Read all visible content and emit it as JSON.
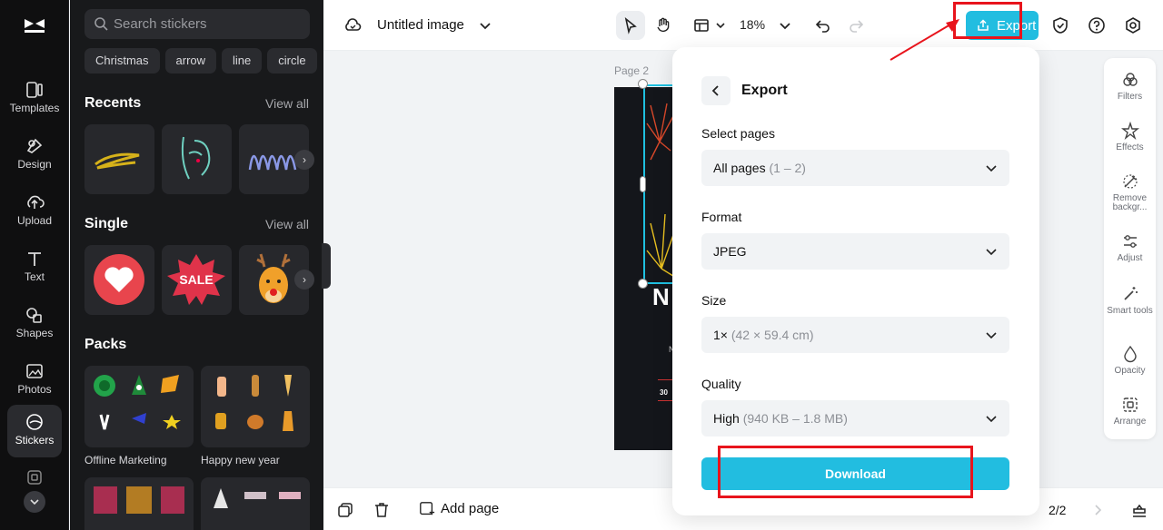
{
  "nav": {
    "items": [
      {
        "label": "Templates",
        "icon": "templates-icon"
      },
      {
        "label": "Design",
        "icon": "design-icon"
      },
      {
        "label": "Upload",
        "icon": "upload-icon"
      },
      {
        "label": "Text",
        "icon": "text-icon"
      },
      {
        "label": "Shapes",
        "icon": "shapes-icon"
      },
      {
        "label": "Photos",
        "icon": "photos-icon"
      },
      {
        "label": "Stickers",
        "icon": "stickers-icon",
        "active": true
      }
    ]
  },
  "stickers": {
    "search_placeholder": "Search stickers",
    "chips": [
      "Christmas",
      "arrow",
      "line",
      "circle"
    ],
    "recents_title": "Recents",
    "single_title": "Single",
    "packs_title": "Packs",
    "view_all": "View all",
    "single_sale_text": "SALE",
    "packs": [
      {
        "label": "Offline Marketing"
      },
      {
        "label": "Happy new year"
      }
    ]
  },
  "header": {
    "title": "Untitled image",
    "zoom": "18%",
    "export_label": "Export"
  },
  "canvas": {
    "page_label": "Page 2"
  },
  "tools": [
    {
      "label": "Filters"
    },
    {
      "label": "Effects"
    },
    {
      "label": "Remove backgr..."
    },
    {
      "label": "Adjust"
    },
    {
      "label": "Smart tools"
    },
    {
      "label": "Opacity"
    },
    {
      "label": "Arrange"
    }
  ],
  "footer": {
    "add_page": "Add page",
    "page_count": "2/2"
  },
  "export": {
    "title": "Export",
    "pages_label": "Select pages",
    "pages_value": "All pages",
    "pages_sub": "(1 – 2)",
    "format_label": "Format",
    "format_value": "JPEG",
    "size_label": "Size",
    "size_value": "1×",
    "size_sub": "(42 × 59.4 cm)",
    "quality_label": "Quality",
    "quality_value": "High",
    "quality_sub": "(940 KB – 1.8 MB)",
    "download_label": "Download"
  },
  "colors": {
    "accent": "#22bde0",
    "annotation": "#e8141c",
    "rail_bg": "#0f0f10",
    "panel_bg": "#18191b"
  }
}
